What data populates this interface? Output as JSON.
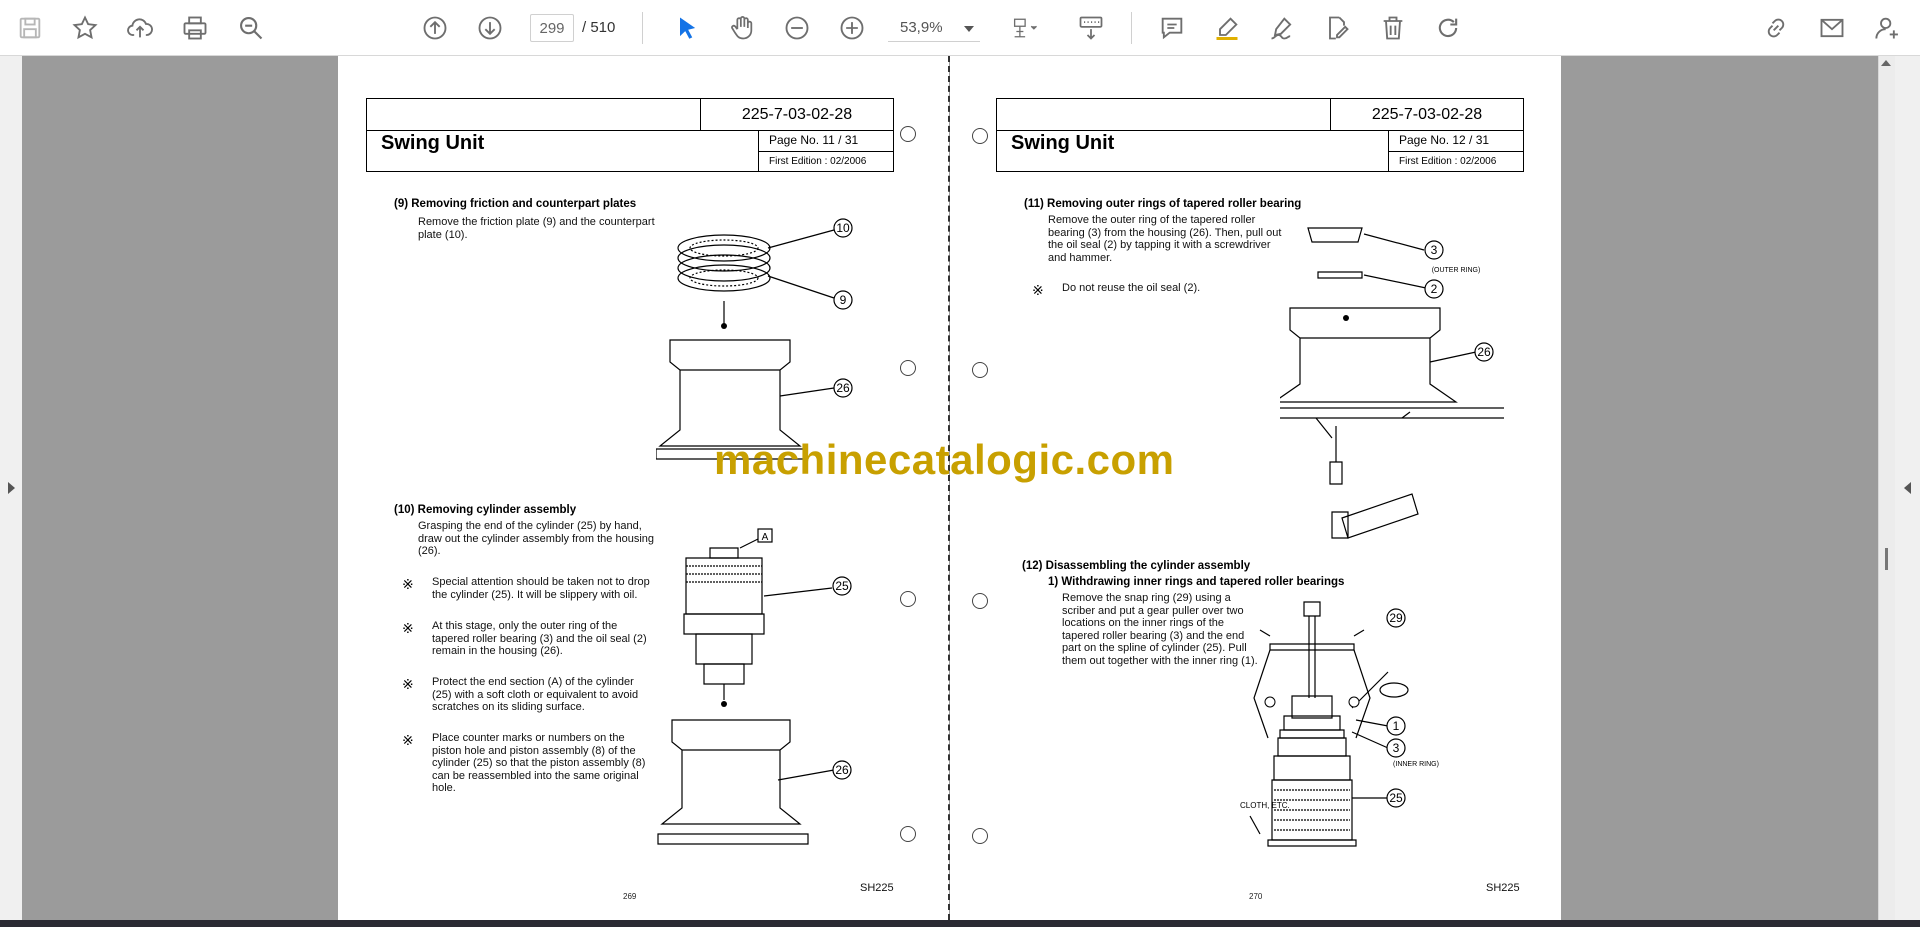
{
  "toolbar": {
    "page_current": "299",
    "page_total": "/  510",
    "zoom": "53,9%"
  },
  "left_page": {
    "doc_no": "225-7-03-02-28",
    "title": "Swing Unit",
    "page_no": "Page No.   11 / 31",
    "edition": "First Edition   : 02/2006",
    "step9_title": "(9)   Removing friction and counterpart plates",
    "step9_body": "Remove the friction plate (9) and the counterpart plate (10).",
    "step10_title": "(10)  Removing cylinder assembly",
    "step10_body": "Grasping the end of the cylinder (25) by hand, draw out the cylinder assembly from the housing (26).",
    "note1": "Special attention should be taken not to drop the cylinder (25). It will be slippery with oil.",
    "note2": "At this stage, only the outer ring of the tapered roller bearing (3) and the oil seal (2) remain in the housing (26).",
    "note3": "Protect the end section (A) of the cylinder (25) with a soft cloth or equivalent to avoid scratches on its sliding surface.",
    "note4": "Place counter marks or numbers on the piston hole and piston assembly (8) of the cylinder (25) so that the piston assembly (8) can be reassembled into the same original hole.",
    "page_number": "269",
    "model": "SH225",
    "callouts": [
      "10",
      "9",
      "26",
      "A",
      "25",
      "26"
    ]
  },
  "right_page": {
    "doc_no": "225-7-03-02-28",
    "title": "Swing Unit",
    "page_no": "Page No.   12 / 31",
    "edition": "First Edition   : 02/2006",
    "step11_title": "(11) Removing outer rings of tapered roller bearing",
    "step11_body": "Remove the outer ring of the tapered roller bearing (3) from the housing (26). Then, pull out the oil seal (2) by tapping it with a screwdriver and hammer.",
    "note_seal": "Do not reuse the oil seal (2).",
    "step12_title": "(12) Disassembling the cylinder assembly",
    "step12_sub": "1)  Withdrawing inner rings and tapered roller bearings",
    "step12_body": "Remove the snap ring (29) using a scriber and put a gear puller over two locations on the inner rings of the tapered roller bearing (3) and the end part on the spline of cylinder (25). Pull them out together with the inner ring (1).",
    "label_outer": "(OUTER RING)",
    "label_inner": "(INNER RING)",
    "label_cloth": "CLOTH, ETC.",
    "page_number": "270",
    "model": "SH225",
    "callouts": [
      "3",
      "2",
      "26",
      "29",
      "1",
      "3",
      "25"
    ]
  },
  "note_mark": "※",
  "watermark": "machinecatalogic.com",
  "colors": {
    "watermark": "#c8a000",
    "active_tool": "#1473e6"
  }
}
